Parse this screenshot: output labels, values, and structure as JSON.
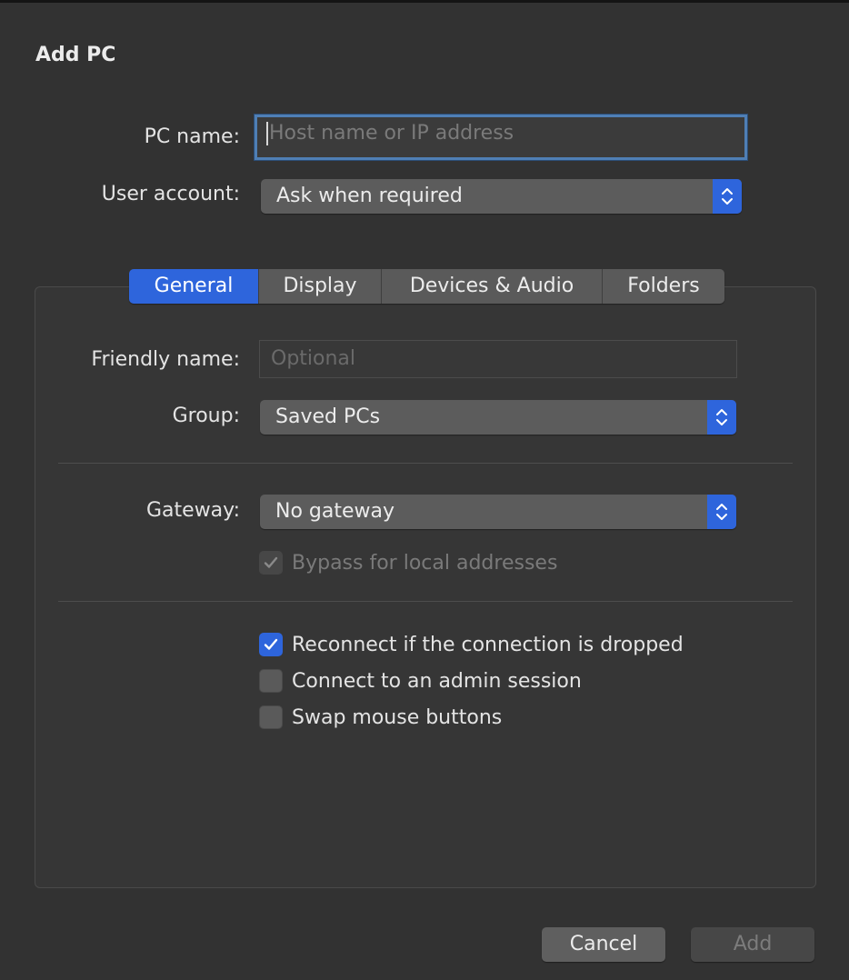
{
  "dialog": {
    "title": "Add PC"
  },
  "pc_name": {
    "label": "PC name:",
    "value": "",
    "placeholder": "Host name or IP address"
  },
  "user_account": {
    "label": "User account:",
    "value": "Ask when required"
  },
  "tabs": [
    {
      "label": "General",
      "active": true
    },
    {
      "label": "Display",
      "active": false
    },
    {
      "label": "Devices & Audio",
      "active": false
    },
    {
      "label": "Folders",
      "active": false
    }
  ],
  "general": {
    "friendly_name": {
      "label": "Friendly name:",
      "value": "",
      "placeholder": "Optional"
    },
    "group": {
      "label": "Group:",
      "value": "Saved PCs"
    },
    "gateway": {
      "label": "Gateway:",
      "value": "No gateway"
    },
    "bypass": {
      "label": "Bypass for local addresses",
      "checked": true,
      "enabled": false
    },
    "options": [
      {
        "label": "Reconnect if the connection is dropped",
        "checked": true
      },
      {
        "label": "Connect to an admin session",
        "checked": false
      },
      {
        "label": "Swap mouse buttons",
        "checked": false
      }
    ]
  },
  "buttons": {
    "cancel": "Cancel",
    "add": "Add",
    "add_enabled": false
  },
  "colors": {
    "accent": "#2e65dc",
    "background": "#323232",
    "focus_ring": "#4f7fb5"
  }
}
